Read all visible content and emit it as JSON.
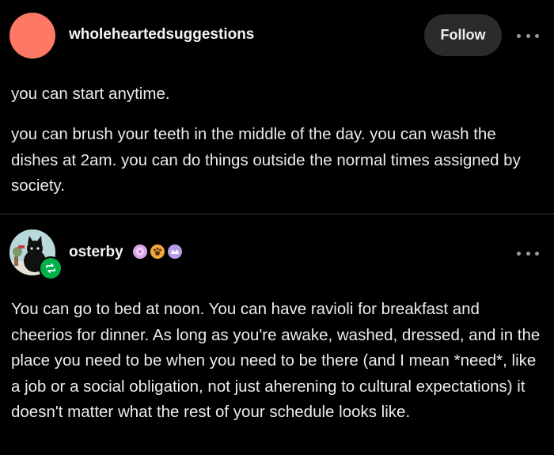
{
  "posts": [
    {
      "username": "wholeheartedsuggestions",
      "follow_label": "Follow",
      "paragraphs": [
        "you can start anytime.",
        "you can brush your teeth in the middle of the day. you can wash the dishes at 2am. you can do things outside the normal times assigned by society."
      ],
      "avatar_color": "#ff7866",
      "icons": {
        "more": "more-options-icon"
      }
    },
    {
      "username": "osterby",
      "badges": [
        "pink-badge-icon",
        "pawprint-badge-icon",
        "purple-badge-icon"
      ],
      "paragraphs": [
        "You can go to bed at noon. You can have ravioli for breakfast and cheerios for dinner. As long as you're awake, washed, dressed, and in the place you need to be when you need to be there (and I mean *need*, like a job or a social obligation, not just aherening to cultural expectations) it doesn't matter what the rest of your schedule looks like."
      ],
      "reblog_color": "#00b04a",
      "icons": {
        "more": "more-options-icon",
        "reblog": "reblog-icon"
      }
    }
  ],
  "colors": {
    "background": "#000000",
    "text": "#ececec",
    "follow_button_bg": "#2b2b2b",
    "divider": "#3a3a3a"
  }
}
